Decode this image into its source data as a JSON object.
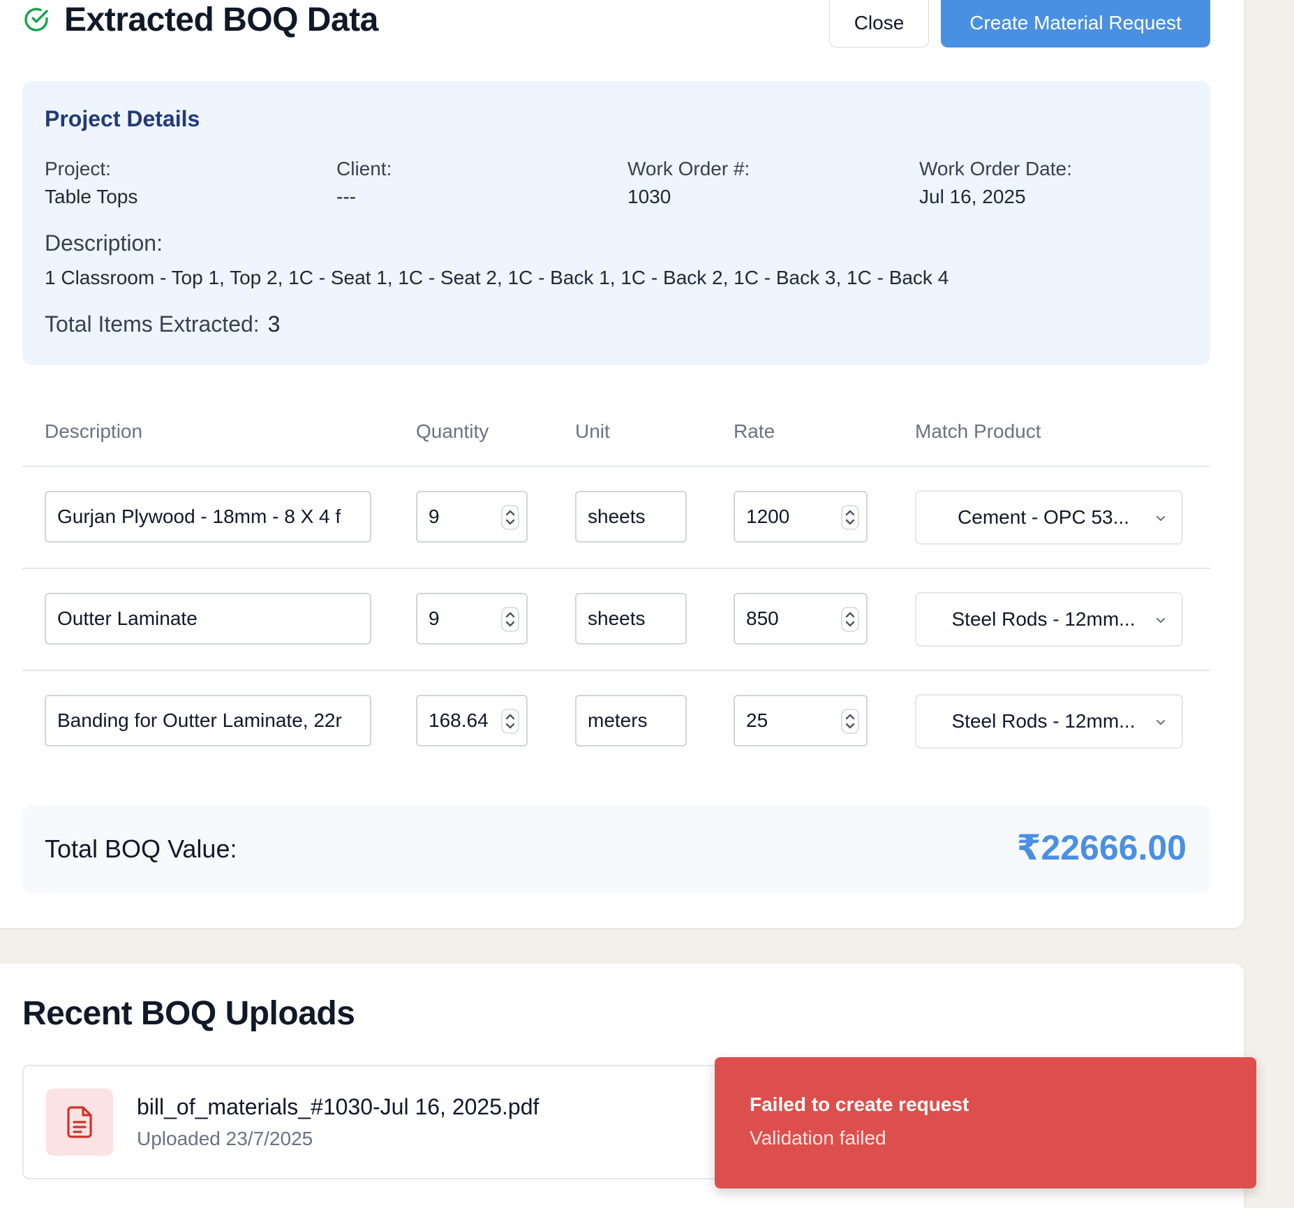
{
  "header": {
    "title": "Extracted BOQ Data",
    "close_label": "Close",
    "create_label": "Create Material Request"
  },
  "project": {
    "section_title": "Project Details",
    "fields": [
      {
        "label": "Project:",
        "value": "Table Tops"
      },
      {
        "label": "Client:",
        "value": "---"
      },
      {
        "label": "Work Order #:",
        "value": "1030"
      },
      {
        "label": "Work Order Date:",
        "value": "Jul 16, 2025"
      }
    ],
    "description_label": "Description:",
    "description": "1 Classroom - Top 1, Top 2, 1C - Seat 1, 1C - Seat 2, 1C - Back 1, 1C - Back 2, 1C - Back 3, 1C - Back 4",
    "total_items_label": "Total Items Extracted:",
    "total_items": "3"
  },
  "table": {
    "headers": [
      "Description",
      "Quantity",
      "Unit",
      "Rate",
      "Match Product"
    ],
    "rows": [
      {
        "description": "Gurjan Plywood - 18mm - 8 X 4 f",
        "quantity": "9",
        "unit": "sheets",
        "rate": "1200",
        "product": "Cement - OPC 53..."
      },
      {
        "description": "Outter Laminate",
        "quantity": "9",
        "unit": "sheets",
        "rate": "850",
        "product": "Steel Rods - 12mm..."
      },
      {
        "description": "Banding for Outter Laminate, 22r",
        "quantity": "168.64",
        "unit": "meters",
        "rate": "25",
        "product": "Steel Rods - 12mm..."
      }
    ]
  },
  "total": {
    "label": "Total BOQ Value:",
    "value": "₹22666.00"
  },
  "recent": {
    "title": "Recent BOQ Uploads",
    "files": [
      {
        "name": "bill_of_materials_#1030-Jul 16, 2025.pdf",
        "uploaded": "Uploaded 23/7/2025"
      }
    ]
  },
  "toast": {
    "title": "Failed to create request",
    "message": "Validation failed"
  },
  "colors": {
    "accent": "#4a90e2",
    "success": "#16a34a",
    "error": "#dd4f4c",
    "project_bg": "#eef5fe",
    "project_title": "#213a78"
  },
  "icons": {
    "header": "check-circle-icon",
    "file": "file-text-icon",
    "spinner": "spinner-arrows-icon",
    "dropdown": "chevron-down-icon"
  }
}
